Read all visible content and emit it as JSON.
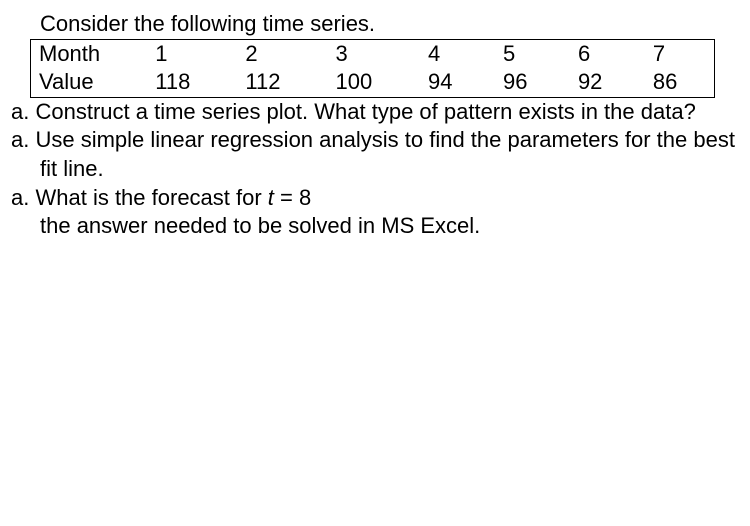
{
  "intro": "Consider the following time series.",
  "table": {
    "row1_label": "Month",
    "row1": [
      "1",
      "2",
      "3",
      "4",
      "5",
      "6",
      "7"
    ],
    "row2_label": "Value",
    "row2": [
      "118",
      "112",
      "100",
      "94",
      "96",
      "92",
      "86"
    ]
  },
  "questions": {
    "q1_marker": "a.",
    "q1_text": "Construct a time series plot. What type of pattern exists in the data?",
    "q2_marker": "a.",
    "q2_text": "Use simple linear regression analysis to find the parameters for the best fit line.",
    "q3_marker": "a.",
    "q3_text_prefix": "What is the forecast for ",
    "q3_var": "t",
    "q3_text_suffix": " = 8"
  },
  "note": "the answer needed to be solved in MS Excel."
}
